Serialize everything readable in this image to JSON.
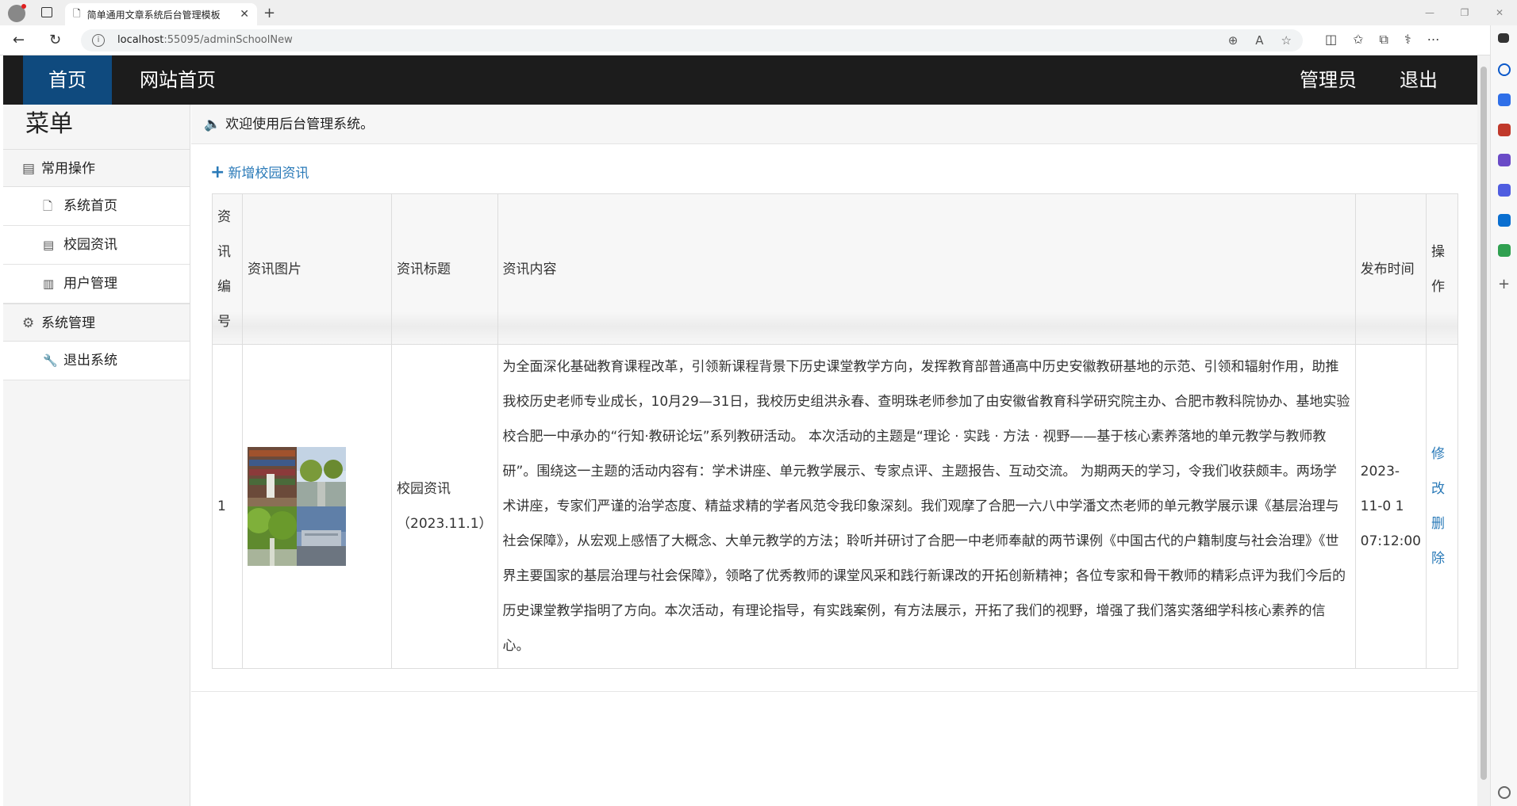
{
  "browser": {
    "tab_title": "简单通用文章系统后台管理模板",
    "url_host": "localhost",
    "url_path": ":55095/adminSchoolNew"
  },
  "nav": {
    "home": "首页",
    "site_home": "网站首页",
    "admin": "管理员",
    "logout": "退出"
  },
  "sidebar": {
    "title": "菜单",
    "groups": [
      {
        "label": "常用操作",
        "items": [
          {
            "label": "系统首页"
          },
          {
            "label": "校园资讯"
          },
          {
            "label": "用户管理"
          }
        ]
      },
      {
        "label": "系统管理",
        "items": [
          {
            "label": "退出系统"
          }
        ]
      }
    ]
  },
  "main": {
    "welcome": "欢迎使用后台管理系统。",
    "add_link": "新增校园资讯",
    "table": {
      "headers": [
        "资讯编号",
        "资讯图片",
        "资讯标题",
        "资讯内容",
        "发布时间",
        "操作"
      ],
      "rows": [
        {
          "id": "1",
          "title": "校园资讯（2023.11.1）",
          "content": "为全面深化基础教育课程改革，引领新课程背景下历史课堂教学方向，发挥教育部普通高中历史安徽教研基地的示范、引领和辐射作用，助推我校历史老师专业成长，10月29—31日，我校历史组洪永春、查明珠老师参加了由安徽省教育科学研究院主办、合肥市教科院协办、基地实验校合肥一中承办的“行知·教研论坛”系列教研活动。 本次活动的主题是“理论 · 实践 · 方法 · 视野——基于核心素养落地的单元教学与教师教研”。围绕这一主题的活动内容有：学术讲座、单元教学展示、专家点评、主题报告、互动交流。 为期两天的学习，令我们收获颇丰。两场学术讲座，专家们严谨的治学态度、精益求精的学者风范令我印象深刻。我们观摩了合肥一六八中学潘文杰老师的单元教学展示课《基层治理与社会保障》，从宏观上感悟了大概念、大单元教学的方法；聆听并研讨了合肥一中老师奉献的两节课例《中国古代的户籍制度与社会治理》《世界主要国家的基层治理与社会保障》，领略了优秀教师的课堂风采和践行新课改的开拓创新精神；各位专家和骨干教师的精彩点评为我们今后的历史课堂教学指明了方向。本次活动，有理论指导，有实践案例，有方法展示，开拓了我们的视野，增强了我们落实落细学科核心素养的信心。",
          "date": "2023-11-0 1 07:12:00",
          "op_edit": "修改",
          "op_delete": "删除"
        }
      ]
    }
  },
  "colors": {
    "topnav_bg": "#1c1c1c",
    "active_nav": "#0f4a7e",
    "link": "#2a7ab8"
  }
}
